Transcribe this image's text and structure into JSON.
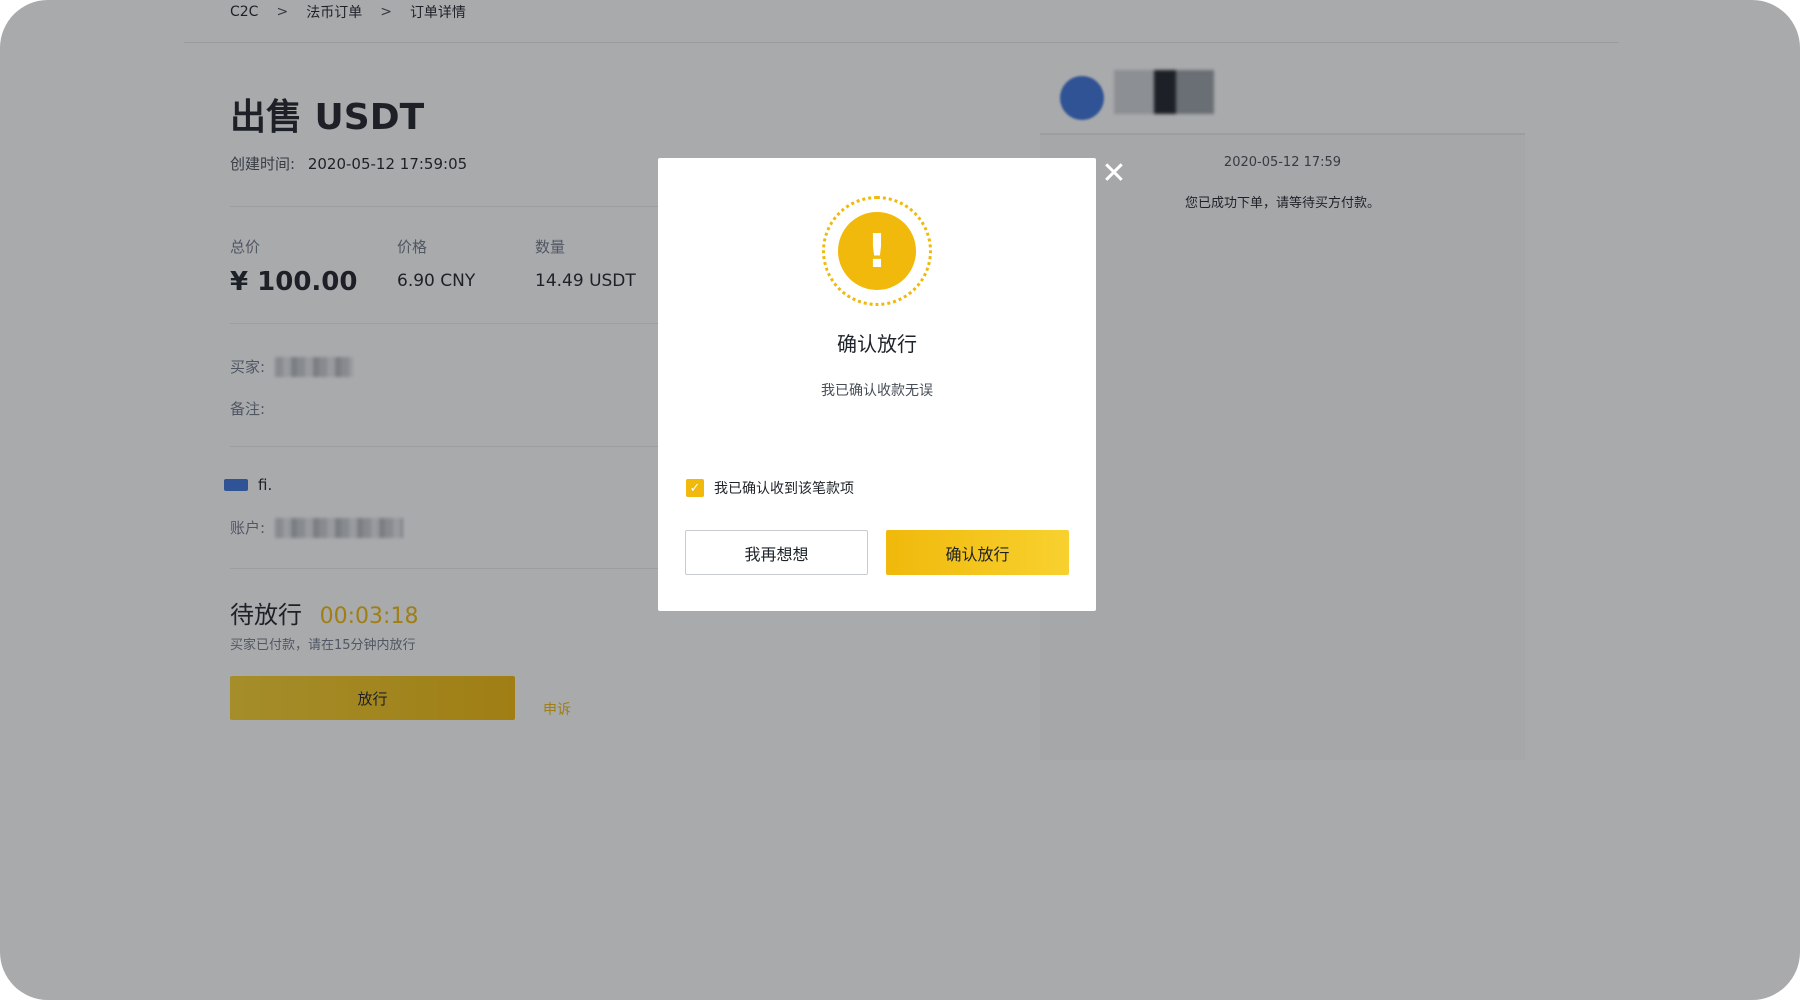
{
  "breadcrumb": {
    "items": [
      "C2C",
      "法币订单",
      "订单详情"
    ],
    "separator": ">"
  },
  "order": {
    "title": "出售 USDT",
    "created_label": "创建时间:",
    "created_value": "2020-05-12 17:59:05",
    "total_label": "总价",
    "total_value": "¥ 100.00",
    "price_label": "价格",
    "price_value": "6.90 CNY",
    "qty_label": "数量",
    "qty_value": "14.49 USDT",
    "buyer_label": "买家:",
    "note_label": "备注:",
    "bank_name": "fi.",
    "account_label": "账户:",
    "status_label": "待放行",
    "timer": "00:03:18",
    "status_note": "买家已付款，请在15分钟内放行",
    "release_button": "放行",
    "appeal_link": "申诉"
  },
  "chat": {
    "time": "2020-05-12 17:59",
    "message": "您已成功下单，请等待买方付款。"
  },
  "modal": {
    "icon": "warning-icon",
    "title": "确认放行",
    "description": "我已确认收款无误",
    "checkbox_label": "我已确认收到该笔款项",
    "checkbox_checked": true,
    "cancel_button": "我再想想",
    "confirm_button": "确认放行",
    "close_icon": "close-icon"
  },
  "colors": {
    "accent": "#f0b90b",
    "text": "#1e2329",
    "muted": "#707a8a",
    "overlay": "rgba(30,32,38,0.38)"
  }
}
